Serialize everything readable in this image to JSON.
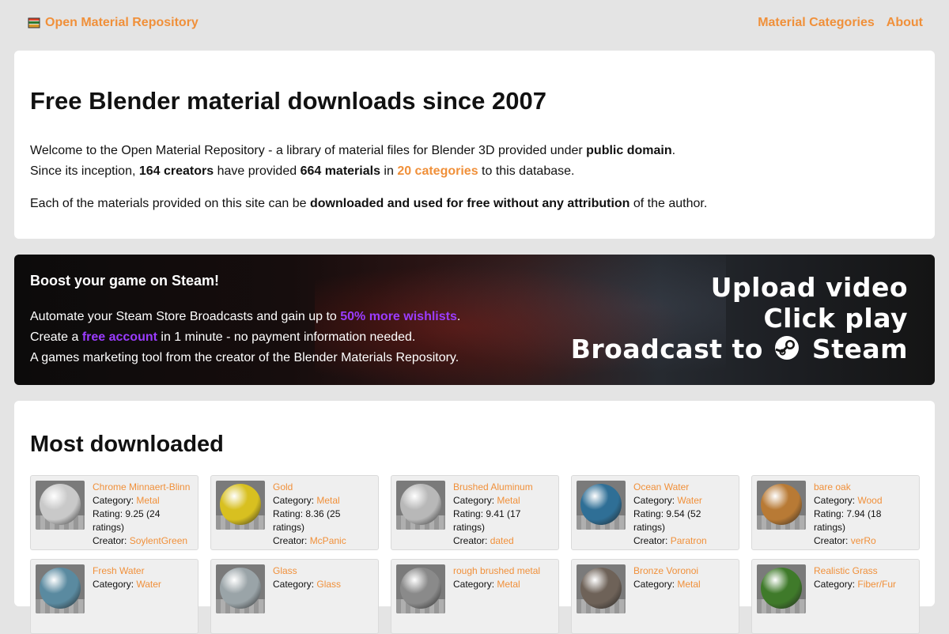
{
  "header": {
    "brand": "Open Material Repository",
    "nav": [
      "Material Categories",
      "About"
    ]
  },
  "intro": {
    "title": "Free Blender material downloads since 2007",
    "line1_a": "Welcome to the Open Material Repository - a library of material files for Blender 3D provided under ",
    "line1_b": "public domain",
    "line1_c": ".",
    "line2_a": "Since its inception, ",
    "line2_b": "164 creators",
    "line2_c": " have provided ",
    "line2_d": "664 materials",
    "line2_e": " in ",
    "line2_link": "20 categories",
    "line2_f": " to this database.",
    "line3_a": "Each of the materials provided on this site can be ",
    "line3_b": "downloaded and used for free without any attribution",
    "line3_c": " of the author."
  },
  "banner": {
    "title": "Boost your game on Steam!",
    "l1_a": "Automate your Steam Store Broadcasts and gain up to ",
    "l1_hl": "50% more wishlists",
    "l1_b": ".",
    "l2_a": "Create a ",
    "l2_hl": "free account",
    "l2_b": " in 1 minute - no payment information needed.",
    "l3": "A games marketing tool from the creator of the Blender Materials Repository.",
    "slogan1": "Upload video",
    "slogan2": "Click play",
    "slogan3_a": "Broadcast to",
    "slogan3_b": "Steam"
  },
  "downloads": {
    "title": "Most downloaded",
    "labels": {
      "category": "Category: ",
      "rating": "Rating: ",
      "creator": "Creator: "
    },
    "items": [
      {
        "name": "Chrome Minnaert-Blinn",
        "category": "Metal",
        "rating": "9.25 (24 ratings)",
        "creator": "SoylentGreen",
        "color": "#c9c9c9"
      },
      {
        "name": "Gold",
        "category": "Metal",
        "rating": "8.36 (25 ratings)",
        "creator": "McPanic",
        "color": "#d8c020"
      },
      {
        "name": "Brushed Aluminum",
        "category": "Metal",
        "rating": "9.41 (17 ratings)",
        "creator": "dated",
        "color": "#b8b8b8"
      },
      {
        "name": "Ocean Water",
        "category": "Water",
        "rating": "9.54 (52 ratings)",
        "creator": "Paratron",
        "color": "#2f6f96"
      },
      {
        "name": "bare oak",
        "category": "Wood",
        "rating": "7.94 (18 ratings)",
        "creator": "verRo",
        "color": "#b87a35"
      },
      {
        "name": "Fresh Water",
        "category": "Water",
        "rating": "",
        "creator": "",
        "color": "#5a8aa0"
      },
      {
        "name": "Glass",
        "category": "Glass",
        "rating": "",
        "creator": "",
        "color": "#9aa4a8"
      },
      {
        "name": "rough brushed metal",
        "category": "Metal",
        "rating": "",
        "creator": "",
        "color": "#8a8a8a"
      },
      {
        "name": "Bronze Voronoi",
        "category": "Metal",
        "rating": "",
        "creator": "",
        "color": "#6e6258"
      },
      {
        "name": "Realistic Grass",
        "category": "Fiber/Fur",
        "rating": "",
        "creator": "",
        "color": "#3f7a2a"
      }
    ]
  }
}
